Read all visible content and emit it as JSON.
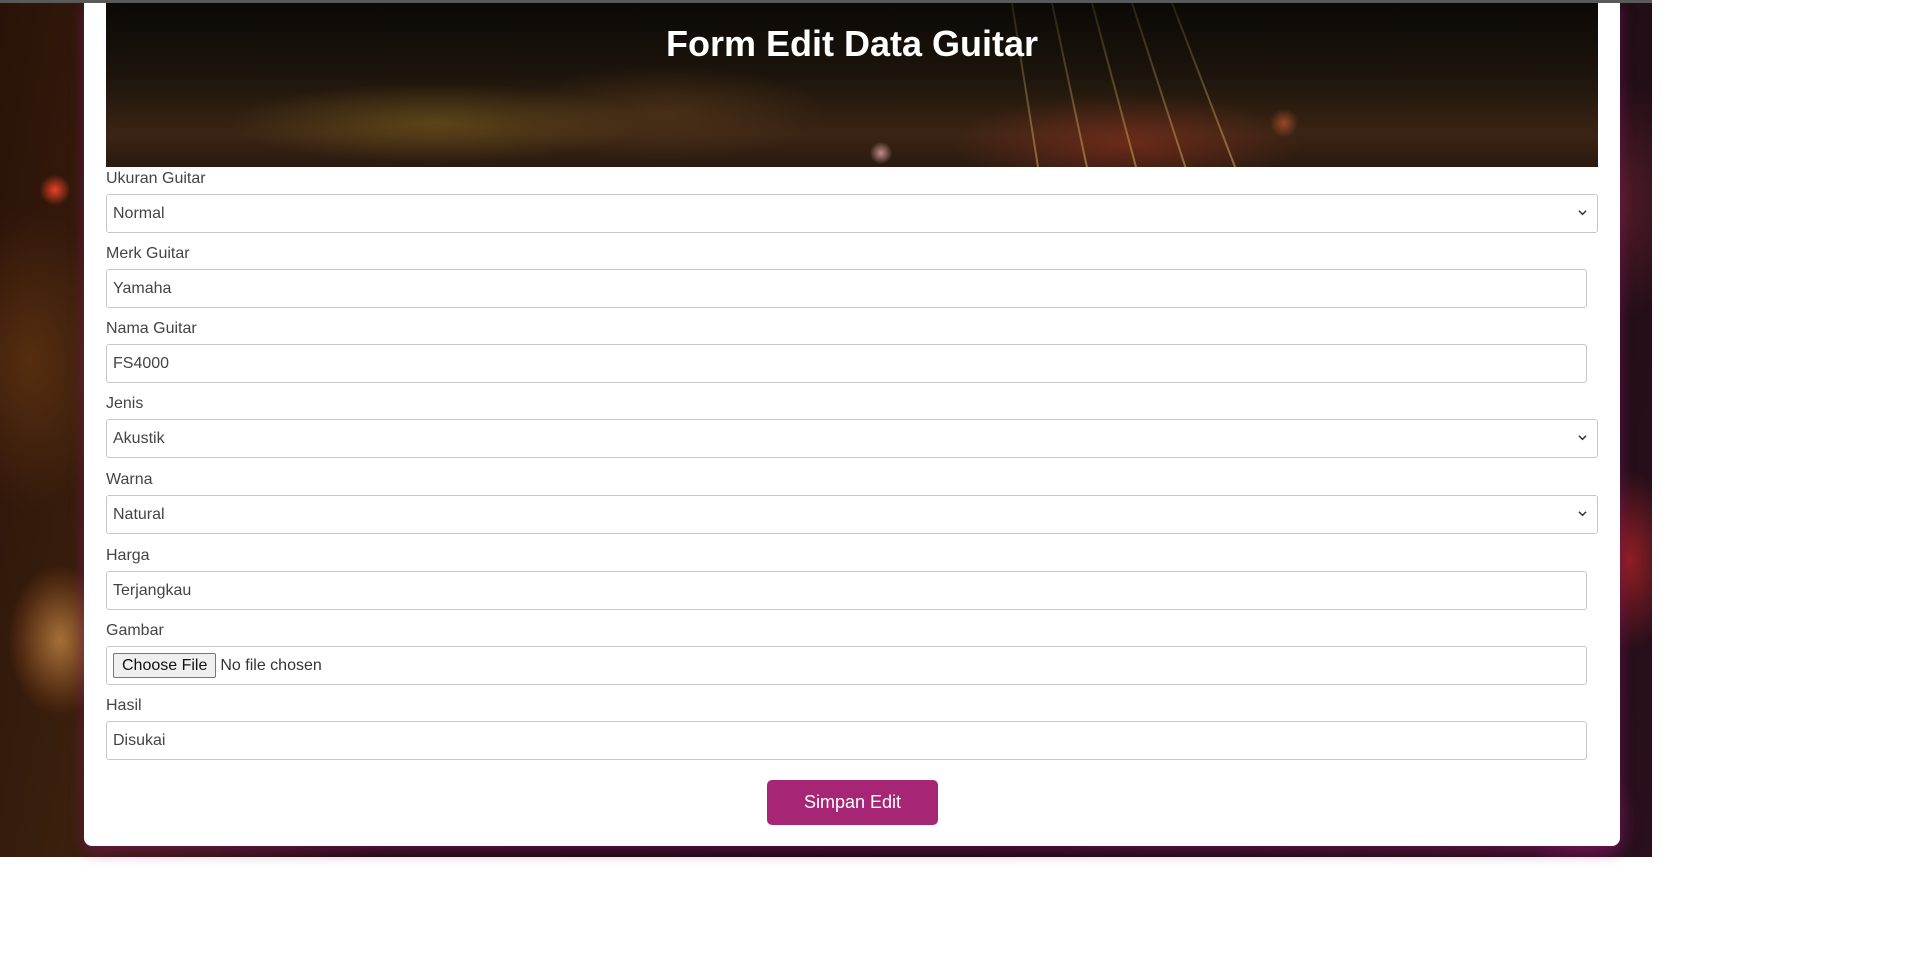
{
  "header": {
    "title": "Form Edit Data Guitar"
  },
  "form": {
    "ukuran": {
      "label": "Ukuran Guitar",
      "value": "Normal",
      "icon": "chevron-down-icon"
    },
    "merk": {
      "label": "Merk Guitar",
      "value": "Yamaha"
    },
    "nama": {
      "label": "Nama Guitar",
      "value": "FS4000"
    },
    "jenis": {
      "label": "Jenis",
      "value": "Akustik",
      "icon": "chevron-down-icon"
    },
    "warna": {
      "label": "Warna",
      "value": "Natural",
      "icon": "chevron-down-icon"
    },
    "harga": {
      "label": "Harga",
      "value": "Terjangkau"
    },
    "gambar": {
      "label": "Gambar",
      "button_label": "Choose File",
      "status": "No file chosen"
    },
    "hasil": {
      "label": "Hasil",
      "value": "Disukai"
    },
    "submit_label": "Simpan Edit"
  },
  "colors": {
    "accent": "#a62675",
    "card_background": "#ffffff",
    "label_text": "#444444"
  }
}
